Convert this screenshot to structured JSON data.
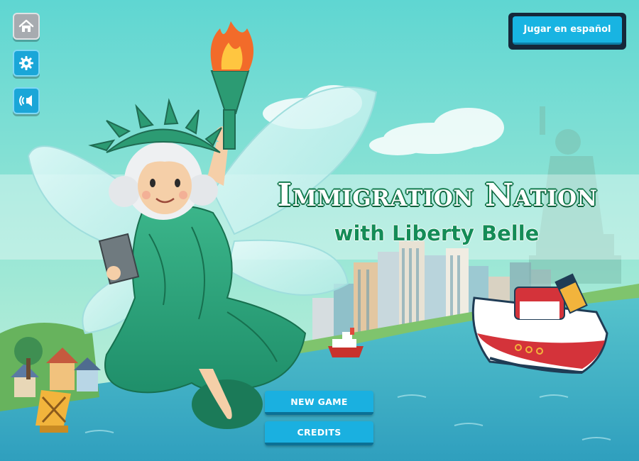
{
  "title": {
    "main": "Immigration Nation",
    "subtitle": "with Liberty Belle"
  },
  "language_button": {
    "label": "Jugar en español"
  },
  "menu": {
    "new_game": "NEW GAME",
    "credits": "CREDITS"
  },
  "side_buttons": [
    {
      "name": "home",
      "icon": "home-icon"
    },
    {
      "name": "settings",
      "icon": "gear-icon"
    },
    {
      "name": "audio",
      "icon": "speaker-icon"
    }
  ],
  "colors": {
    "sky": "#6fd9d0",
    "water": "#3fb6c8",
    "button_blue": "#1ab0e0",
    "title_green": "#127a4c",
    "home_gray": "#a7abb0"
  }
}
